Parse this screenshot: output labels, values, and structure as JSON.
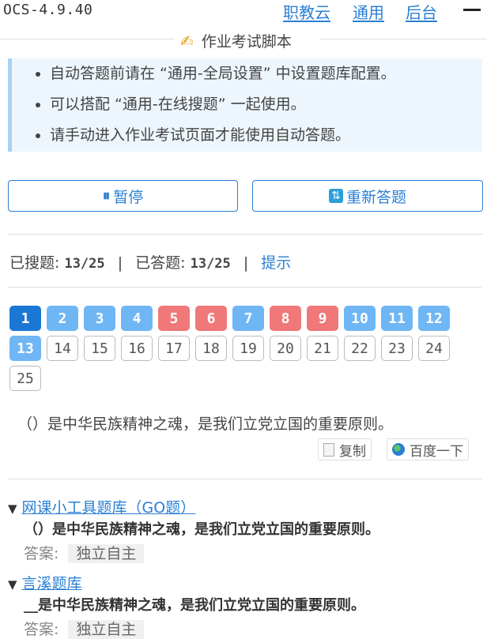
{
  "header": {
    "version": "OCS-4.9.40",
    "nav": [
      "职教云",
      "通用",
      "后台"
    ]
  },
  "title": {
    "icon": "writing-hand-icon",
    "text": "作业考试脚本"
  },
  "notice": {
    "items": [
      "自动答题前请在 “通用-全局设置” 中设置题库配置。",
      "可以搭配 “通用-在线搜题” 一起使用。",
      "请手动进入作业考试页面才能使用自动答题。"
    ]
  },
  "buttons": {
    "pause": {
      "icon": "pause-icon",
      "glyph": "⏸",
      "label": "暂停"
    },
    "redo": {
      "icon": "refresh-icon",
      "glyph": "⇅",
      "label": "重新答题"
    }
  },
  "stats": {
    "searched_label": "已搜题:",
    "searched_value": "13/25",
    "answered_label": "已答题:",
    "answered_value": "13/25",
    "separator": "|",
    "hint": "提示"
  },
  "questions": [
    {
      "n": "1",
      "state": "current"
    },
    {
      "n": "2",
      "state": "found"
    },
    {
      "n": "3",
      "state": "found"
    },
    {
      "n": "4",
      "state": "found"
    },
    {
      "n": "5",
      "state": "fail"
    },
    {
      "n": "6",
      "state": "fail"
    },
    {
      "n": "7",
      "state": "found"
    },
    {
      "n": "8",
      "state": "fail"
    },
    {
      "n": "9",
      "state": "fail"
    },
    {
      "n": "10",
      "state": "found"
    },
    {
      "n": "11",
      "state": "found"
    },
    {
      "n": "12",
      "state": "found"
    },
    {
      "n": "13",
      "state": "found"
    },
    {
      "n": "14",
      "state": "empty"
    },
    {
      "n": "15",
      "state": "empty"
    },
    {
      "n": "16",
      "state": "empty"
    },
    {
      "n": "17",
      "state": "empty"
    },
    {
      "n": "18",
      "state": "empty"
    },
    {
      "n": "19",
      "state": "empty"
    },
    {
      "n": "20",
      "state": "empty"
    },
    {
      "n": "21",
      "state": "empty"
    },
    {
      "n": "22",
      "state": "empty"
    },
    {
      "n": "23",
      "state": "empty"
    },
    {
      "n": "24",
      "state": "empty"
    },
    {
      "n": "25",
      "state": "empty"
    }
  ],
  "colors": {
    "current": "#1a78d4",
    "found": "#6fb6f5",
    "fail": "#f07878",
    "accent": "#2a7fd4"
  },
  "question": {
    "text": "（）是中华民族精神之魂，是我们立党立国的重要原则。",
    "copy_label": "复制",
    "baidu_label": "百度一下"
  },
  "results": [
    {
      "source": "网课小工具题库（GO题）",
      "question": "（）是中华民族精神之魂，是我们立党立国的重要原则。",
      "answer_label": "答案:",
      "answer": "独立自主"
    },
    {
      "source": "言溪题库",
      "question": "__是中华民族精神之魂，是我们立党立国的重要原则。",
      "answer_label": "答案:",
      "answer": "独立自主"
    }
  ]
}
